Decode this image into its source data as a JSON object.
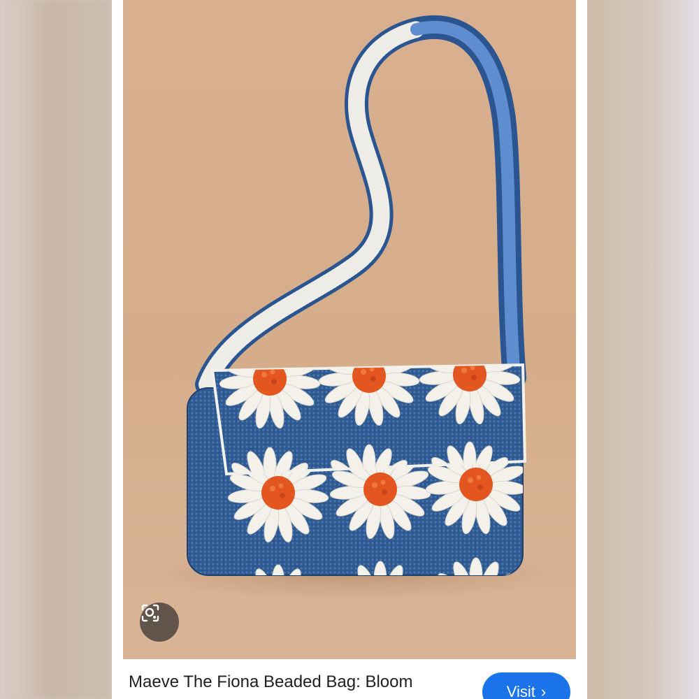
{
  "result": {
    "title": "Maeve The Fiona Beaded Bag: Bloom",
    "visit_label": "Visit",
    "visit_icon": "chevron-right-icon",
    "lens_icon": "lens-search-icon"
  },
  "colors": {
    "accent": "#1a73e8",
    "backdrop": "#d5ad8b",
    "bag_blue": "#2f5a93",
    "bead_white": "#f2f1ec",
    "bead_orange": "#e4561f"
  }
}
